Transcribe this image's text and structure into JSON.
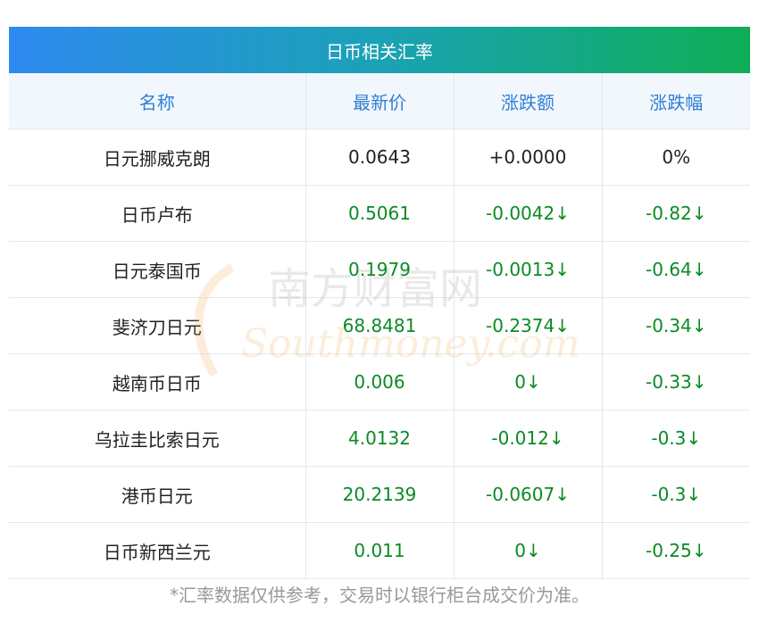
{
  "title": "日币相关汇率",
  "headers": [
    "名称",
    "最新价",
    "涨跌额",
    "涨跌幅"
  ],
  "rows": [
    {
      "name": "日元挪威克朗",
      "price": "0.0643",
      "change": "+0.0000",
      "pct": "0%",
      "trend": "flat"
    },
    {
      "name": "日币卢布",
      "price": "0.5061",
      "change": "-0.0042↓",
      "pct": "-0.82↓",
      "trend": "down"
    },
    {
      "name": "日元泰国币",
      "price": "0.1979",
      "change": "-0.0013↓",
      "pct": "-0.64↓",
      "trend": "down"
    },
    {
      "name": "斐济刀日元",
      "price": "68.8481",
      "change": "-0.2374↓",
      "pct": "-0.34↓",
      "trend": "down"
    },
    {
      "name": "越南币日币",
      "price": "0.006",
      "change": "0↓",
      "pct": "-0.33↓",
      "trend": "down"
    },
    {
      "name": "乌拉圭比索日元",
      "price": "4.0132",
      "change": "-0.012↓",
      "pct": "-0.3↓",
      "trend": "down"
    },
    {
      "name": "港币日元",
      "price": "20.2139",
      "change": "-0.0607↓",
      "pct": "-0.3↓",
      "trend": "down"
    },
    {
      "name": "日币新西兰元",
      "price": "0.011",
      "change": "0↓",
      "pct": "-0.25↓",
      "trend": "down"
    }
  ],
  "footnote": "*汇率数据仅供参考，交易时以银行柜台成交价为准。",
  "watermark": {
    "cn": "南方财富网",
    "en": "Southmoney.com"
  },
  "colors": {
    "header_text": "#2f7fd6",
    "down": "#0b8a24",
    "gradient_start": "#2f8af0",
    "gradient_end": "#0fae55"
  }
}
